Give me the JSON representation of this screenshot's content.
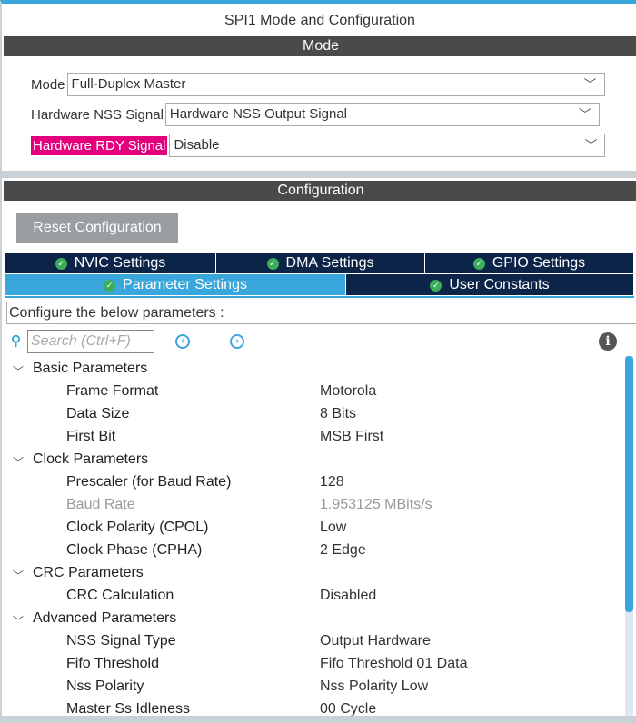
{
  "title": "SPI1 Mode and Configuration",
  "mode_header": "Mode",
  "mode": {
    "mode_label": "Mode",
    "mode_value": "Full-Duplex Master",
    "nss_label": "Hardware NSS Signal",
    "nss_value": "Hardware NSS Output Signal",
    "rdy_label": "Hardware RDY Signal",
    "rdy_value": "Disable"
  },
  "config_header": "Configuration",
  "reset_button": "Reset Configuration",
  "tabs": [
    {
      "label": "NVIC Settings"
    },
    {
      "label": "DMA Settings"
    },
    {
      "label": "GPIO Settings"
    },
    {
      "label": "Parameter Settings"
    },
    {
      "label": "User Constants"
    }
  ],
  "configure_text": "Configure the below parameters :",
  "search_placeholder": "Search (Ctrl+F)",
  "groups": [
    {
      "name": "Basic Parameters",
      "params": [
        [
          "Frame Format",
          "Motorola"
        ],
        [
          "Data Size",
          "8 Bits"
        ],
        [
          "First Bit",
          "MSB First"
        ]
      ]
    },
    {
      "name": "Clock Parameters",
      "params": [
        [
          "Prescaler (for Baud Rate)",
          "128"
        ],
        [
          "Baud Rate",
          "1.953125 MBits/s"
        ],
        [
          "Clock Polarity (CPOL)",
          "Low"
        ],
        [
          "Clock Phase (CPHA)",
          "2 Edge"
        ]
      ]
    },
    {
      "name": "CRC Parameters",
      "params": [
        [
          "CRC Calculation",
          "Disabled"
        ]
      ]
    },
    {
      "name": "Advanced Parameters",
      "params": [
        [
          "NSS Signal Type",
          "Output Hardware"
        ],
        [
          "Fifo Threshold",
          "Fifo Threshold 01 Data"
        ],
        [
          "Nss Polarity",
          "Nss Polarity Low"
        ],
        [
          "Master Ss Idleness",
          "00 Cycle"
        ]
      ]
    }
  ],
  "scroll_fraction": 0
}
